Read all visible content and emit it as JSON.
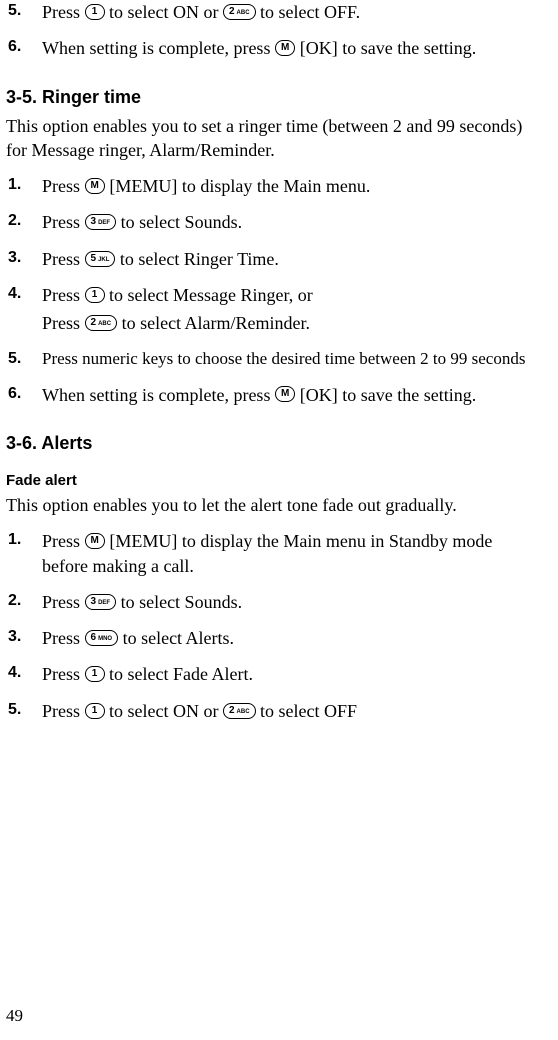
{
  "keys": {
    "k1": {
      "digit": "1",
      "sup": ""
    },
    "k2": {
      "digit": "2",
      "sup": "ABC"
    },
    "k3": {
      "digit": "3",
      "sup": "DEF"
    },
    "k5": {
      "digit": "5",
      "sup": "JKL"
    },
    "k6": {
      "digit": "6",
      "sup": "MNO"
    },
    "kM": {
      "digit": "M",
      "sup": ""
    }
  },
  "top_steps": {
    "s5": {
      "pre": "Press ",
      "mid": " to select ON or ",
      "post": " to select OFF."
    },
    "s6": {
      "pre": "When setting is complete, press ",
      "post": " [OK] to save the setting."
    }
  },
  "section35": {
    "title": "3-5. Ringer time",
    "intro": "This option enables you to set a ringer time (between 2 and 99 seconds) for Message ringer, Alarm/Reminder.",
    "steps": {
      "s1": {
        "pre": "Press ",
        "post": " [MEMU] to display the Main menu."
      },
      "s2": {
        "pre": "Press ",
        "post": " to select Sounds."
      },
      "s3": {
        "pre": "Press ",
        "post": " to select Ringer Time."
      },
      "s4": {
        "line1_pre": "Press ",
        "line1_post": " to select Message Ringer, or",
        "line2_pre": "Press ",
        "line2_post": " to select Alarm/Reminder."
      },
      "s5": {
        "text": "Press numeric keys to choose the desired time between 2 to 99 seconds"
      },
      "s6": {
        "pre": "When setting is complete, press ",
        "post": " [OK] to save the setting."
      }
    }
  },
  "section36": {
    "title": "3-6. Alerts",
    "sub_title": "Fade alert",
    "intro": "This option enables you to let the alert tone fade out gradually.",
    "steps": {
      "s1": {
        "pre": "Press ",
        "post": " [MEMU] to display the Main menu in Standby mode before making a call."
      },
      "s2": {
        "pre": "Press ",
        "post": " to select Sounds."
      },
      "s3": {
        "pre": "Press ",
        "post": " to select Alerts."
      },
      "s4": {
        "pre": "Press ",
        "post": " to select Fade Alert."
      },
      "s5": {
        "pre": "Press ",
        "mid": " to select ON or ",
        "post": " to select OFF"
      }
    }
  },
  "page_number": "49"
}
